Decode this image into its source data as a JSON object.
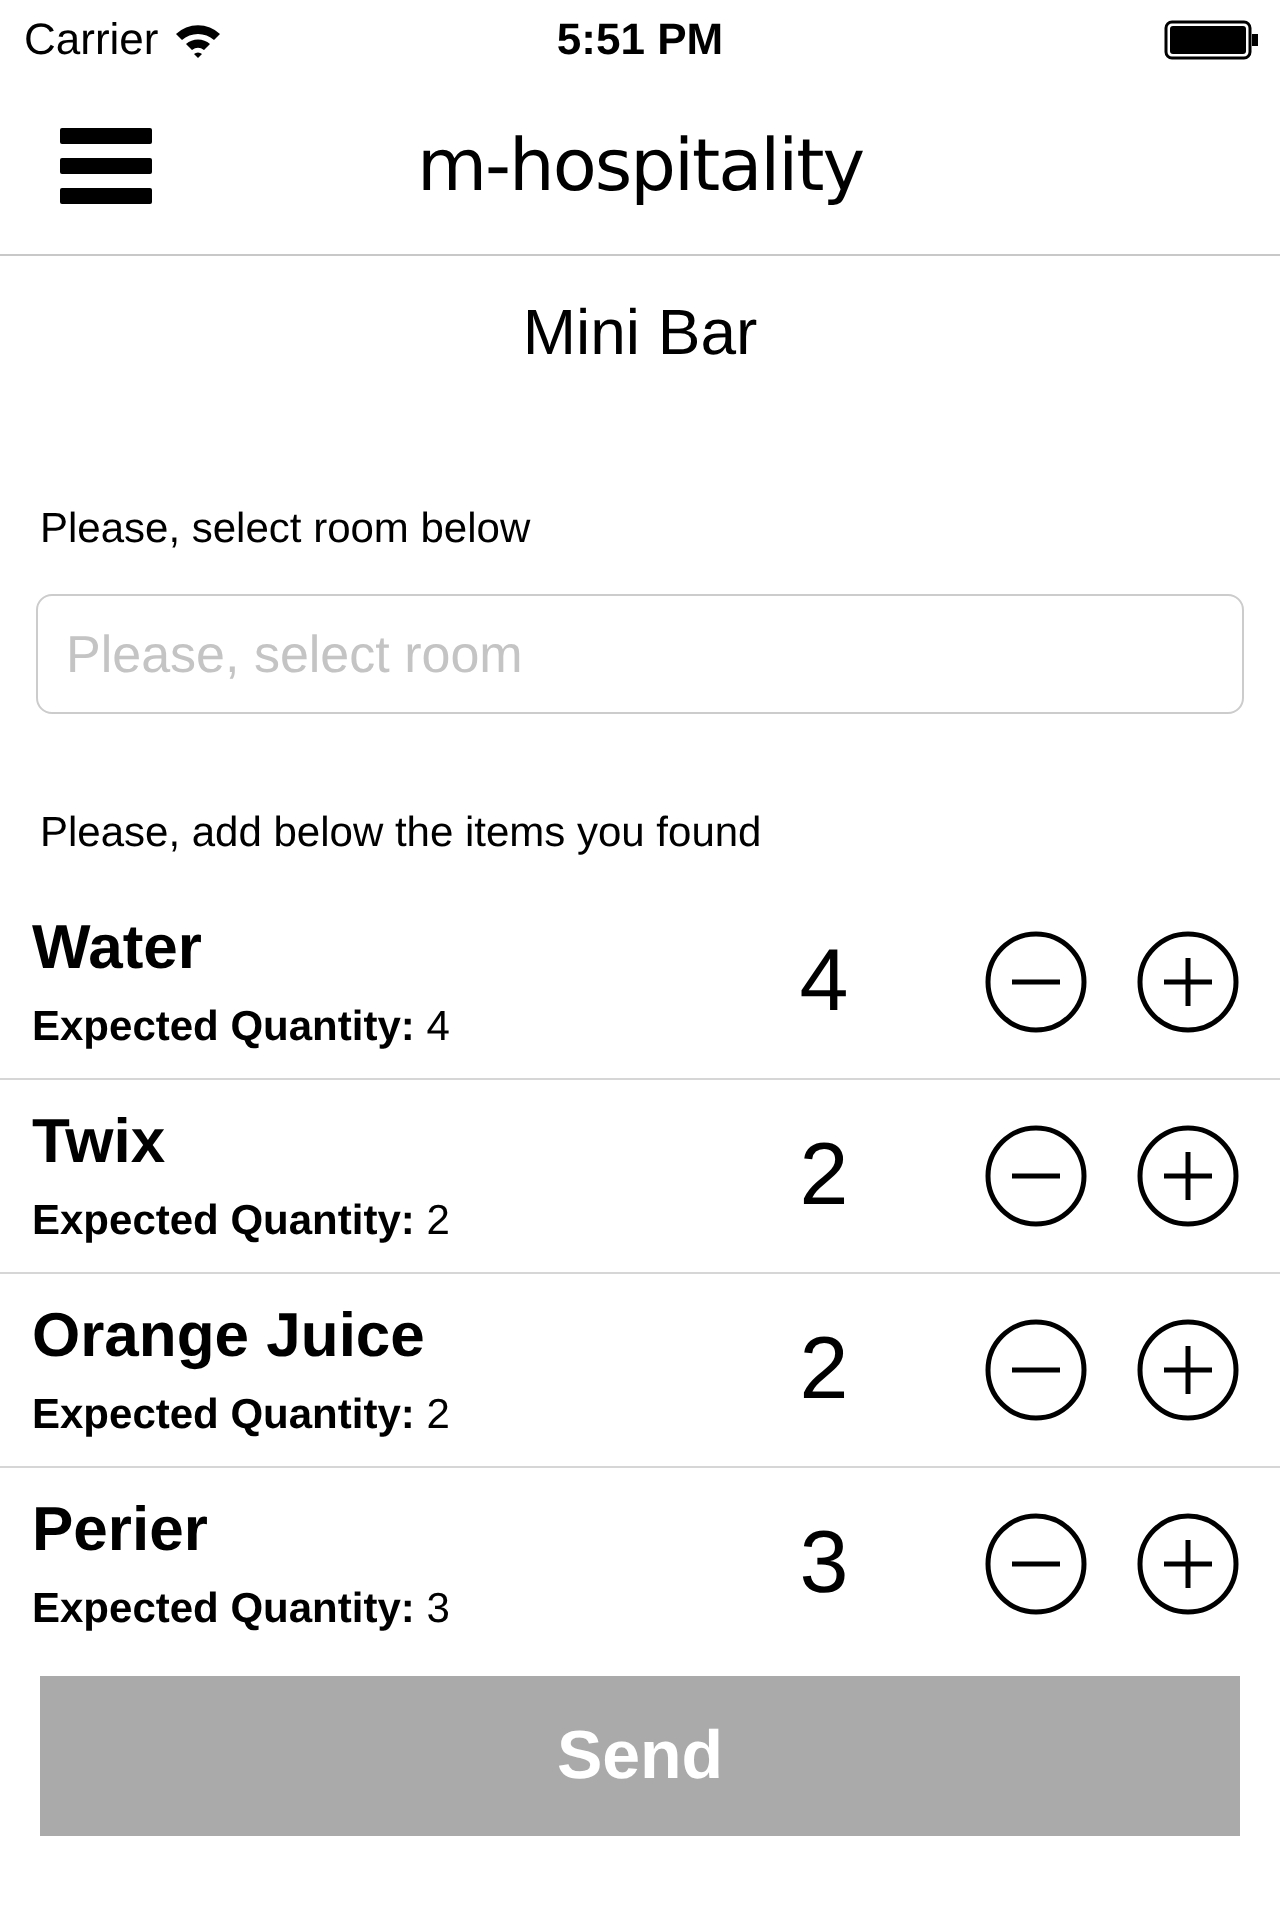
{
  "status_bar": {
    "carrier": "Carrier",
    "time": "5:51 PM"
  },
  "nav_bar": {
    "logo": "m-hospitality"
  },
  "title": "Mini Bar",
  "room": {
    "label": "Please, select room below",
    "placeholder": "Please, select room"
  },
  "items_label": "Please, add below the items you found",
  "items": [
    {
      "name": "Water",
      "expected_label": "Expected Quantity:",
      "expected": "4",
      "quantity": "4"
    },
    {
      "name": "Twix",
      "expected_label": "Expected Quantity:",
      "expected": "2",
      "quantity": "2"
    },
    {
      "name": "Orange Juice",
      "expected_label": "Expected Quantity:",
      "expected": "2",
      "quantity": "2"
    },
    {
      "name": "Perier",
      "expected_label": "Expected Quantity:",
      "expected": "3",
      "quantity": "3"
    }
  ],
  "send_button": {
    "label": "Send",
    "disabled": true
  }
}
